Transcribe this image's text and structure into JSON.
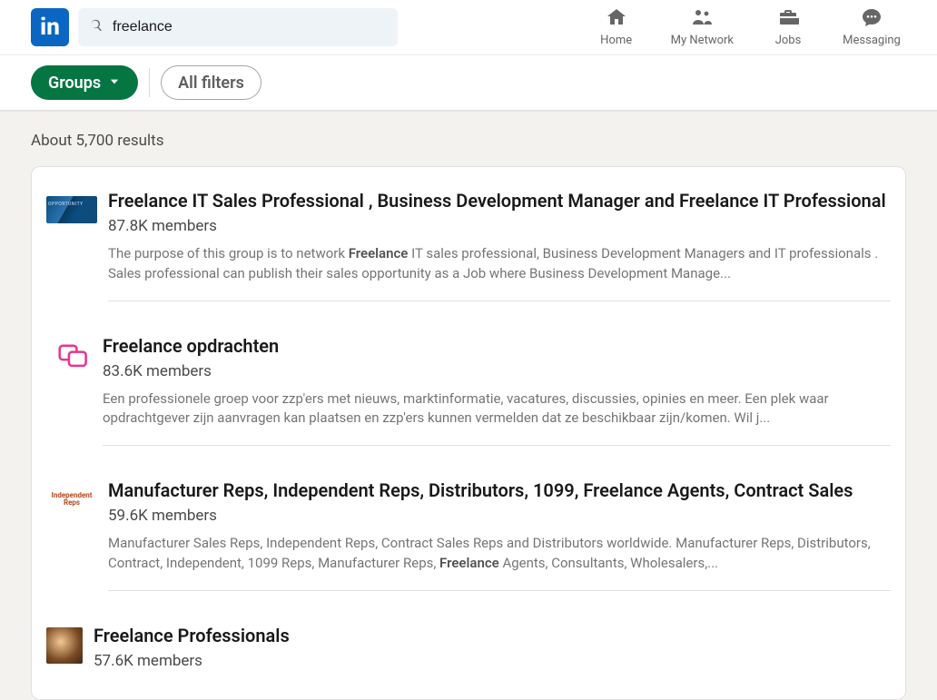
{
  "logo_text": "in",
  "search": {
    "value": "freelance"
  },
  "nav": [
    {
      "label": "Home"
    },
    {
      "label": "My Network"
    },
    {
      "label": "Jobs"
    },
    {
      "label": "Messaging"
    }
  ],
  "filters": {
    "active": "Groups",
    "all_filters": "All filters"
  },
  "results_count": "About 5,700 results",
  "results": [
    {
      "title": "Freelance IT Sales Professional , Business Development Manager and Freelance IT Professional",
      "members": "87.8K members",
      "desc_pre": "The purpose of this group is to network ",
      "desc_bold": "Freelance",
      "desc_post": " IT sales professional, Business Development Managers and IT professionals . Sales professional can publish their sales opportunity as a Job where Business Development Manage..."
    },
    {
      "title": "Freelance opdrachten",
      "members": "83.6K members",
      "desc_pre": "Een professionele groep voor zzp'ers met nieuws, marktinformatie, vacatures, discussies, opinies en meer. Een plek waar opdrachtgever zijn aanvragen kan plaatsen en zzp'ers kunnen vermelden dat ze beschikbaar zijn/komen. Wil j...",
      "desc_bold": "",
      "desc_post": ""
    },
    {
      "title": "Manufacturer Reps, Independent Reps, Distributors, 1099, Freelance Agents, Contract Sales",
      "members": "59.6K members",
      "desc_pre": "Manufacturer Sales Reps, Independent Reps, Contract Sales Reps and Distributors worldwide. Manufacturer Reps, Distributors, Contract, Independent, 1099 Reps, Manufacturer Reps, ",
      "desc_bold": "Freelance",
      "desc_post": " Agents, Consultants, Wholesalers,..."
    },
    {
      "title": "Freelance Professionals",
      "members": "57.6K members",
      "desc_pre": "",
      "desc_bold": "",
      "desc_post": ""
    }
  ],
  "thumb3_text": "Independent\nReps"
}
